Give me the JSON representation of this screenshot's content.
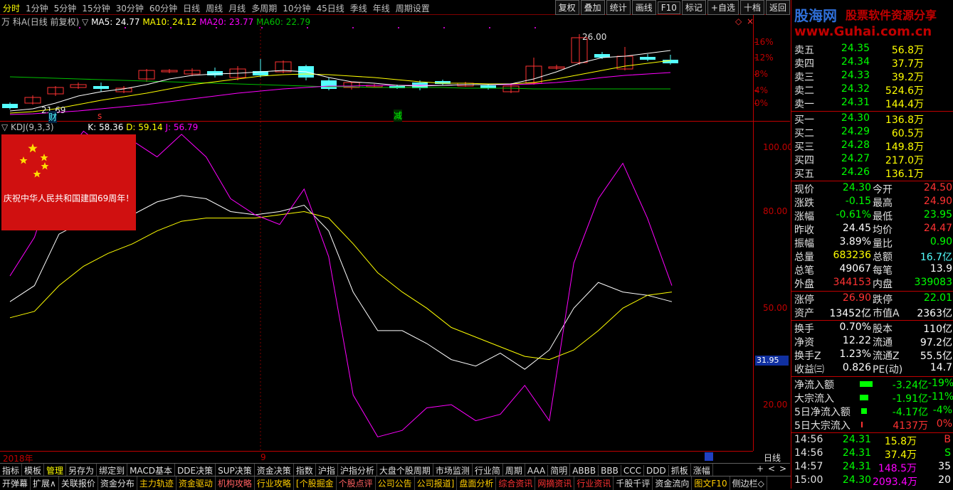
{
  "period_bar": {
    "items": [
      "分时",
      "1分钟",
      "5分钟",
      "15分钟",
      "30分钟",
      "60分钟",
      "日线",
      "周线",
      "月线",
      "多周期",
      "10分钟",
      "45日线",
      "季线",
      "年线",
      "周期设置"
    ],
    "active": "分时",
    "right_buttons": [
      "复权",
      "叠加",
      "统计",
      "画线",
      "F10",
      "标记",
      "+自选",
      "十档",
      "返回"
    ]
  },
  "logo": {
    "title": "股海网",
    "subtitle": "股票软件资源分享",
    "url": "www.Guhai.com.cn"
  },
  "price_chart": {
    "legend_name": "万 科A(日线 前复权)",
    "ma5_label": "MA5: 24.77",
    "ma10_label": "MA10: 24.12",
    "ma20_label": "MA20: 23.77",
    "ma60_label": "MA60: 22.79",
    "high_mark": "26.00",
    "low_mark": "21.69",
    "marker_cai": "财",
    "marker_jian": "减",
    "marker_s": "s",
    "pct_ticks": [
      "16%",
      "12%",
      "8%",
      "4%",
      "0%"
    ],
    "colors": {
      "ma5": "#ffffff",
      "ma10": "#ffff00",
      "ma20": "#ff00ff",
      "ma60": "#00c000",
      "up": "#ff3232",
      "down": "#54ffff"
    }
  },
  "kdj": {
    "legend_name": "KDJ(9,3,3)",
    "k_label": "K: 58.36",
    "d_label": "D: 59.14",
    "j_label": "J: 56.79",
    "ticks": [
      "100.00",
      "80.00",
      "50.00",
      "20.00"
    ],
    "cursor_value": "31.95",
    "banner_text": "庆祝中华人民共和国建国69周年！"
  },
  "chart_data": {
    "type": "line",
    "series": [
      {
        "name": "K",
        "values": [
          52,
          57,
          73,
          77,
          78,
          79,
          83,
          85,
          84,
          80,
          79,
          80,
          82,
          74,
          55,
          43,
          43,
          39,
          34,
          32,
          36,
          31,
          37,
          50,
          58,
          55,
          54,
          52
        ]
      },
      {
        "name": "D",
        "values": [
          47,
          49,
          57,
          63,
          67,
          70,
          74,
          77,
          78,
          78,
          78,
          79,
          80,
          78,
          70,
          61,
          55,
          50,
          44,
          41,
          38,
          35,
          34,
          37,
          43,
          50,
          54,
          55
        ]
      },
      {
        "name": "J",
        "values": [
          60,
          72,
          95,
          105,
          99,
          102,
          97,
          104,
          97,
          84,
          79,
          76,
          87,
          66,
          23,
          10,
          12,
          19,
          20,
          15,
          17,
          26,
          15,
          64,
          84,
          95,
          78,
          57
        ]
      }
    ],
    "ylim": [
      10,
      110
    ]
  },
  "time_axis": {
    "year_label": "2018年",
    "month_label": "9",
    "period_label": "日线"
  },
  "quote_panel": {
    "asks": [
      {
        "label": "卖五",
        "price": "24.35",
        "vol": "56.8万"
      },
      {
        "label": "卖四",
        "price": "24.34",
        "vol": "37.7万"
      },
      {
        "label": "卖三",
        "price": "24.33",
        "vol": "39.2万"
      },
      {
        "label": "卖二",
        "price": "24.32",
        "vol": "524.6万"
      },
      {
        "label": "卖一",
        "price": "24.31",
        "vol": "144.4万"
      }
    ],
    "bids": [
      {
        "label": "买一",
        "price": "24.30",
        "vol": "136.8万"
      },
      {
        "label": "买二",
        "price": "24.29",
        "vol": "60.5万"
      },
      {
        "label": "买三",
        "price": "24.28",
        "vol": "149.8万"
      },
      {
        "label": "买四",
        "price": "24.27",
        "vol": "217.0万"
      },
      {
        "label": "买五",
        "price": "24.26",
        "vol": "136.1万"
      }
    ],
    "stats1": [
      {
        "l1": "现价",
        "v1": "24.30",
        "c1": "#00ff00",
        "l2": "今开",
        "v2": "24.50",
        "c2": "#ff3232"
      },
      {
        "l1": "涨跌",
        "v1": "-0.15",
        "c1": "#00ff00",
        "l2": "最高",
        "v2": "24.90",
        "c2": "#ff3232"
      },
      {
        "l1": "涨幅",
        "v1": "-0.61%",
        "c1": "#00ff00",
        "l2": "最低",
        "v2": "23.95",
        "c2": "#00ff00"
      },
      {
        "l1": "昨收",
        "v1": "24.45",
        "c1": "#ffffff",
        "l2": "均价",
        "v2": "24.47",
        "c2": "#ff3232"
      },
      {
        "l1": "振幅",
        "v1": "3.89%",
        "c1": "#ffffff",
        "l2": "量比",
        "v2": "0.90",
        "c2": "#00ff00"
      },
      {
        "l1": "总量",
        "v1": "683236",
        "c1": "#ffff00",
        "l2": "总额",
        "v2": "16.7亿",
        "c2": "#54ffff"
      },
      {
        "l1": "总笔",
        "v1": "49067",
        "c1": "#ffffff",
        "l2": "每笔",
        "v2": "13.9",
        "c2": "#ffffff"
      },
      {
        "l1": "外盘",
        "v1": "344153",
        "c1": "#ff3232",
        "l2": "内盘",
        "v2": "339083",
        "c2": "#00ff00"
      }
    ],
    "stats2": [
      {
        "l1": "涨停",
        "v1": "26.90",
        "c1": "#ff3232",
        "l2": "跌停",
        "v2": "22.01",
        "c2": "#00ff00"
      },
      {
        "l1": "资产",
        "v1": "13452亿",
        "c1": "#ffffff",
        "l2": "市值A",
        "v2": "2363亿",
        "c2": "#ffffff"
      }
    ],
    "stats3": [
      {
        "l1": "换手",
        "v1": "0.70%",
        "c1": "#ffffff",
        "l2": "股本",
        "v2": "110亿",
        "c2": "#ffffff"
      },
      {
        "l1": "净资",
        "v1": "12.22",
        "c1": "#ffffff",
        "l2": "流通",
        "v2": "97.2亿",
        "c2": "#ffffff"
      },
      {
        "l1": "换手Z",
        "v1": "1.23%",
        "c1": "#ffffff",
        "l2": "流通Z",
        "v2": "55.5亿",
        "c2": "#ffffff"
      },
      {
        "l1": "收益㈢",
        "v1": "0.826",
        "c1": "#ffffff",
        "l2": "PE(动)",
        "v2": "14.7",
        "c2": "#ffffff"
      }
    ],
    "flows": [
      {
        "label": "净流入额",
        "bar": 0.6,
        "v1": "-3.24亿",
        "v2": "-19%",
        "color": "#00ff00"
      },
      {
        "label": "大宗流入",
        "bar": 0.4,
        "v1": "-1.91亿",
        "v2": "-11%",
        "color": "#00ff00"
      },
      {
        "label": "5日净流入额",
        "bar": 0.25,
        "v1": "-4.17亿",
        "v2": "-4%",
        "color": "#00ff00"
      },
      {
        "label": "5日大宗流入",
        "bar": 0.05,
        "v1": "4137万",
        "v2": "0%",
        "color": "#ff3232"
      }
    ],
    "ticks": [
      {
        "time": "14:56",
        "price": "24.31",
        "vol": "15.8万",
        "side": "B",
        "vcol": "#ffff00",
        "scol": "#ff3232"
      },
      {
        "time": "14:56",
        "price": "24.31",
        "vol": "37.4万",
        "side": "S",
        "vcol": "#ffff00",
        "scol": "#00ff00"
      },
      {
        "time": "14:57",
        "price": "24.31",
        "vol": "148.5万",
        "side": "35",
        "vcol": "#ff00ff",
        "scol": "#ffffff"
      },
      {
        "time": "15:00",
        "price": "24.30",
        "vol": "2093.4万",
        "side": "20",
        "vcol": "#ff00ff",
        "scol": "#ffffff"
      }
    ]
  },
  "bottom_tabs1": [
    "指标",
    "模板",
    "管理",
    "另存为",
    "绑定到",
    "MACD基本",
    "DDE决策",
    "SUP决策",
    "资金决策",
    "指数",
    "沪指",
    "沪指分析",
    "大盘个股周期",
    "市场监测",
    "行业简",
    "周期",
    "AAA",
    "简明",
    "ABBB",
    "BBB",
    "CCC",
    "DDD",
    "抓板",
    "涨幅"
  ],
  "bottom_tabs1_active": "管理",
  "bottom_tabs1_right": [
    "+",
    "<",
    ">"
  ],
  "bottom_tabs2": [
    {
      "label": "开弹幕",
      "color": "#e0e0e0"
    },
    {
      "label": "扩展∧",
      "color": "#e0e0e0"
    },
    {
      "label": "关联报价",
      "color": "#e0e0e0"
    },
    {
      "label": "资金分布",
      "color": "#e0e0e0"
    },
    {
      "label": "主力轨迹",
      "color": "#ffcc00"
    },
    {
      "label": "资金驱动",
      "color": "#ffcc00"
    },
    {
      "label": "机构攻略",
      "color": "#ff6060"
    },
    {
      "label": "行业攻略",
      "color": "#ffcc00"
    },
    {
      "label": "[个股掘金",
      "color": "#ffcc00"
    },
    {
      "label": "个股点评",
      "color": "#ff6060"
    },
    {
      "label": "公司公告",
      "color": "#ffcc00"
    },
    {
      "label": "公司报道]",
      "color": "#ffcc00"
    },
    {
      "label": "盘面分析",
      "color": "#ffcc00"
    },
    {
      "label": "综合资讯",
      "color": "#ff3232"
    },
    {
      "label": "网摘资讯",
      "color": "#ff3232"
    },
    {
      "label": "行业资讯",
      "color": "#ff3232"
    },
    {
      "label": "千股千评",
      "color": "#e0e0e0"
    },
    {
      "label": "资金流向",
      "color": "#e0e0e0"
    },
    {
      "label": "图文F10",
      "color": "#ffcc00"
    },
    {
      "label": "侧边栏◇",
      "color": "#e0e0e0"
    }
  ],
  "bottom_tabs2_right": [
    "笔",
    "价",
    "细",
    "势",
    "联",
    "值",
    "主",
    "筹"
  ]
}
